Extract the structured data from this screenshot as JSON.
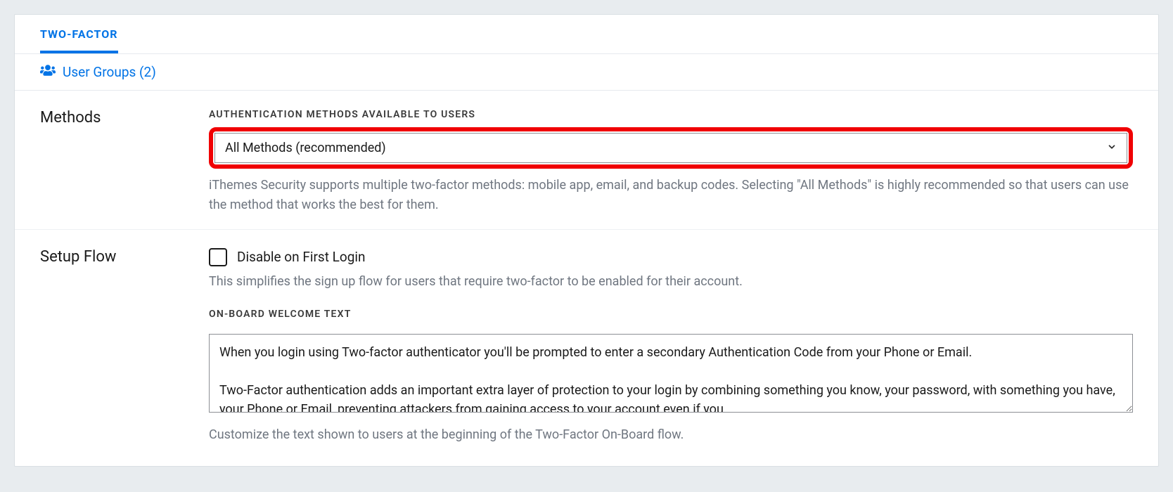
{
  "tab": {
    "label": "TWO-FACTOR"
  },
  "userGroups": {
    "label": "User Groups (2)"
  },
  "methods": {
    "sectionTitle": "Methods",
    "fieldLabel": "AUTHENTICATION METHODS AVAILABLE TO USERS",
    "selectedValue": "All Methods (recommended)",
    "helpText": "iThemes Security supports multiple two-factor methods: mobile app, email, and backup codes. Selecting \"All Methods\" is highly recommended so that users can use the method that works the best for them."
  },
  "setupFlow": {
    "sectionTitle": "Setup Flow",
    "disableFirstLogin": {
      "label": "Disable on First Login",
      "checked": false,
      "helpText": "This simplifies the sign up flow for users that require two-factor to be enabled for their account."
    },
    "onboard": {
      "fieldLabel": "ON-BOARD WELCOME TEXT",
      "value": "When you login using Two-factor authenticator you'll be prompted to enter a secondary Authentication Code from your Phone or Email.\n\nTwo-Factor authentication adds an important extra layer of protection to your login by combining something you know, your password, with something you have, your Phone or Email, preventing attackers from gaining access to your account even if you",
      "helpText": "Customize the text shown to users at the beginning of the Two-Factor On-Board flow."
    }
  }
}
